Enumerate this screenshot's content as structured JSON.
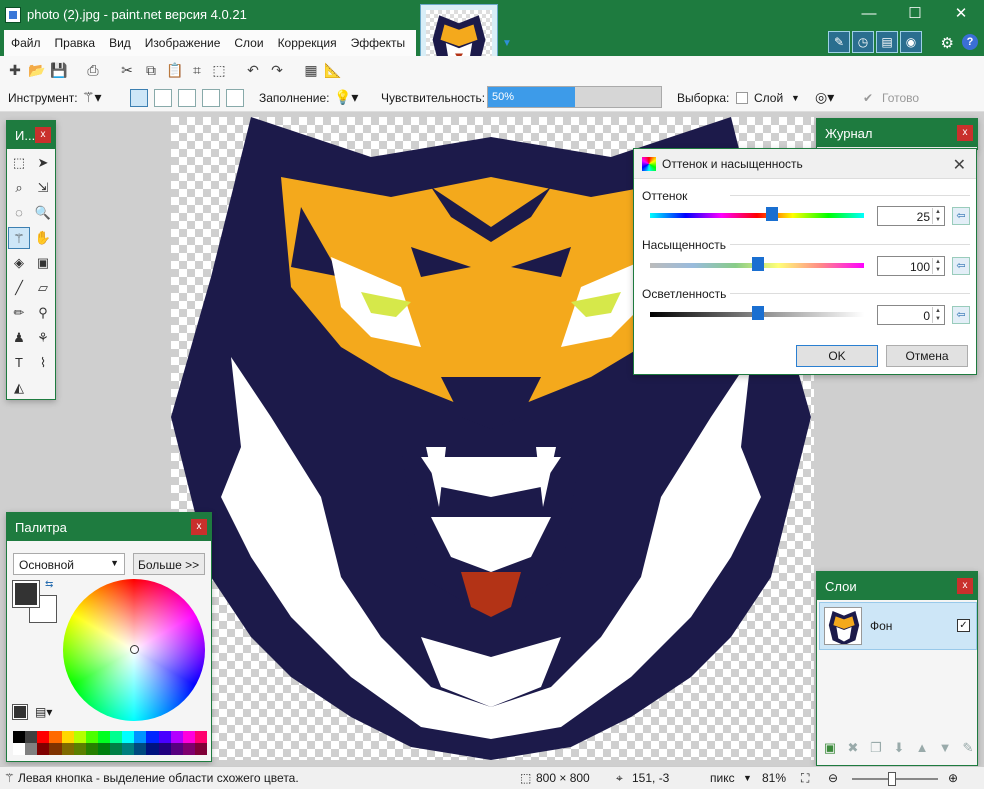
{
  "window": {
    "title": "photo (2).jpg - paint.net версия 4.0.21",
    "controls": {
      "minimize": "—",
      "maximize": "☐",
      "close": "✕"
    }
  },
  "menu": [
    "Файл",
    "Правка",
    "Вид",
    "Изображение",
    "Слои",
    "Коррекция",
    "Эффекты"
  ],
  "quick_icons": [
    "tools-icon",
    "history-icon",
    "layers-icon",
    "colors-icon"
  ],
  "settings_icon": "⚙",
  "help_label": "?",
  "toolbar": {
    "icons": [
      "new-image-icon",
      "open-icon",
      "save-icon",
      "print-icon",
      "cut-icon",
      "copy-icon",
      "paste-icon",
      "crop-icon",
      "deselect-icon",
      "undo-icon",
      "redo-icon",
      "grid-icon",
      "ruler-icon"
    ],
    "tool_label": "Инструмент:",
    "fill_label": "Заполнение:",
    "sensitivity_label": "Чувствительность:",
    "sensitivity_value": "50%",
    "sensitivity_fraction": 0.5,
    "sampling_label": "Выборка:",
    "sampling_value": "Слой",
    "done_label": "Готово"
  },
  "tools_panel": {
    "title": "И...",
    "close": "x",
    "tools": [
      "rectangle-select-icon",
      "move-selection-icon",
      "lasso-select-icon",
      "move-selected-icon",
      "ellipse-select-icon",
      "zoom-icon",
      "magic-wand-icon",
      "pan-icon",
      "paint-bucket-icon",
      "gradient-icon",
      "paintbrush-icon",
      "eraser-icon",
      "pencil-icon",
      "color-picker-icon",
      "clone-stamp-icon",
      "recolor-icon",
      "text-icon",
      "line-curve-icon",
      "shapes-icon"
    ]
  },
  "palette": {
    "title": "Палитра",
    "close": "x",
    "mode": "Основной",
    "more": "Больше >>",
    "primary_color": "#333333",
    "secondary_color": "#ffffff",
    "swatches": [
      "#000000",
      "#404040",
      "#ff0000",
      "#ff6a00",
      "#ffd800",
      "#b6ff00",
      "#4cff00",
      "#00ff21",
      "#00ff90",
      "#00ffff",
      "#0094ff",
      "#0026ff",
      "#4800ff",
      "#b200ff",
      "#ff00dc",
      "#ff006e",
      "#ffffff",
      "#808080",
      "#7f0000",
      "#7f3300",
      "#7f6a00",
      "#5b7f00",
      "#267f00",
      "#007f0e",
      "#007f46",
      "#007f7f",
      "#004a7f",
      "#00137f",
      "#21007f",
      "#57007f",
      "#7f006e",
      "#7f0037"
    ]
  },
  "dialog": {
    "title": "Оттенок и насыщенность",
    "close": "✕",
    "hue_label": "Оттенок",
    "hue_value": "25",
    "saturation_label": "Насыщенность",
    "saturation_value": "100",
    "lightness_label": "Осветленность",
    "lightness_value": "0",
    "ok": "OK",
    "cancel": "Отмена"
  },
  "journal": {
    "title": "Журнал",
    "close": "x"
  },
  "layers": {
    "title": "Слои",
    "close": "x",
    "layer_name": "Фон",
    "checked": "✓"
  },
  "status": {
    "hint": "Левая кнопка - выделение области схожего цвета.",
    "size": "800 × 800",
    "position": "151, -3",
    "unit": "пикс",
    "zoom": "81%"
  }
}
